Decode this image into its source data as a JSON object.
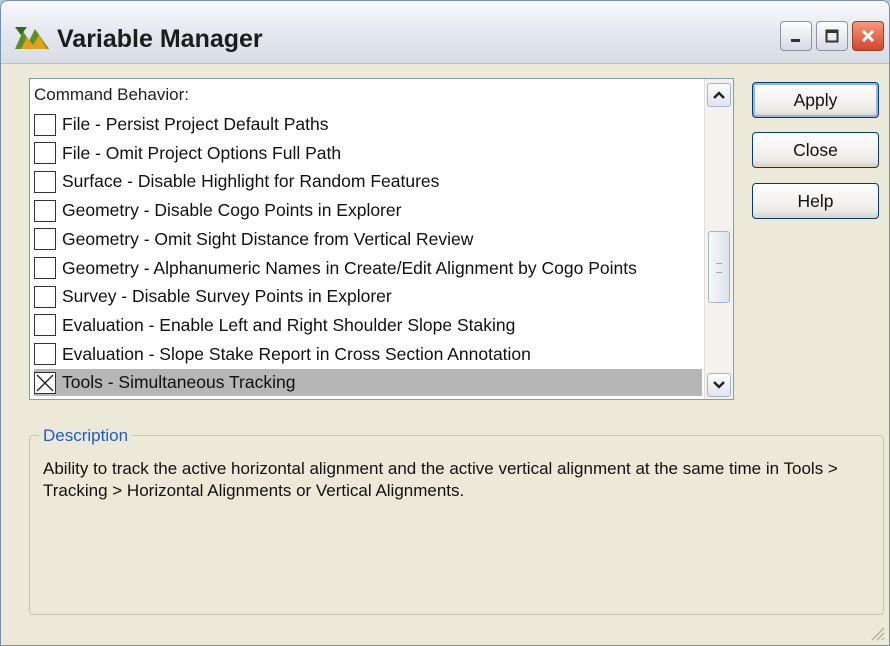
{
  "window": {
    "title": "Variable Manager",
    "controls": {
      "minimize_icon": "minimize-icon",
      "maximize_icon": "maximize-icon",
      "close_icon": "close-icon"
    }
  },
  "list": {
    "group_header": "Command Behavior:",
    "items": [
      {
        "label": "File - Persist Project Default Paths",
        "checked": false
      },
      {
        "label": "File - Omit Project Options Full Path",
        "checked": false
      },
      {
        "label": "Surface - Disable Highlight for Random Features",
        "checked": false
      },
      {
        "label": "Geometry - Disable Cogo Points in Explorer",
        "checked": false
      },
      {
        "label": "Geometry - Omit Sight Distance from Vertical Review",
        "checked": false
      },
      {
        "label": "Geometry - Alphanumeric Names in Create/Edit Alignment by Cogo Points",
        "checked": false
      },
      {
        "label": "Survey - Disable Survey Points in Explorer",
        "checked": false
      },
      {
        "label": "Evaluation - Enable Left and Right Shoulder Slope Staking",
        "checked": false
      },
      {
        "label": "Evaluation - Slope Stake Report in Cross Section Annotation",
        "checked": false
      },
      {
        "label": "Tools - Simultaneous Tracking",
        "checked": true,
        "selected": true
      }
    ]
  },
  "buttons": {
    "apply": "Apply",
    "close": "Close",
    "help": "Help"
  },
  "description": {
    "legend": "Description",
    "text": "Ability to track the active horizontal alignment and the active vertical alignment at the same time in Tools > Tracking > Horizontal Alignments or Vertical Alignments."
  }
}
